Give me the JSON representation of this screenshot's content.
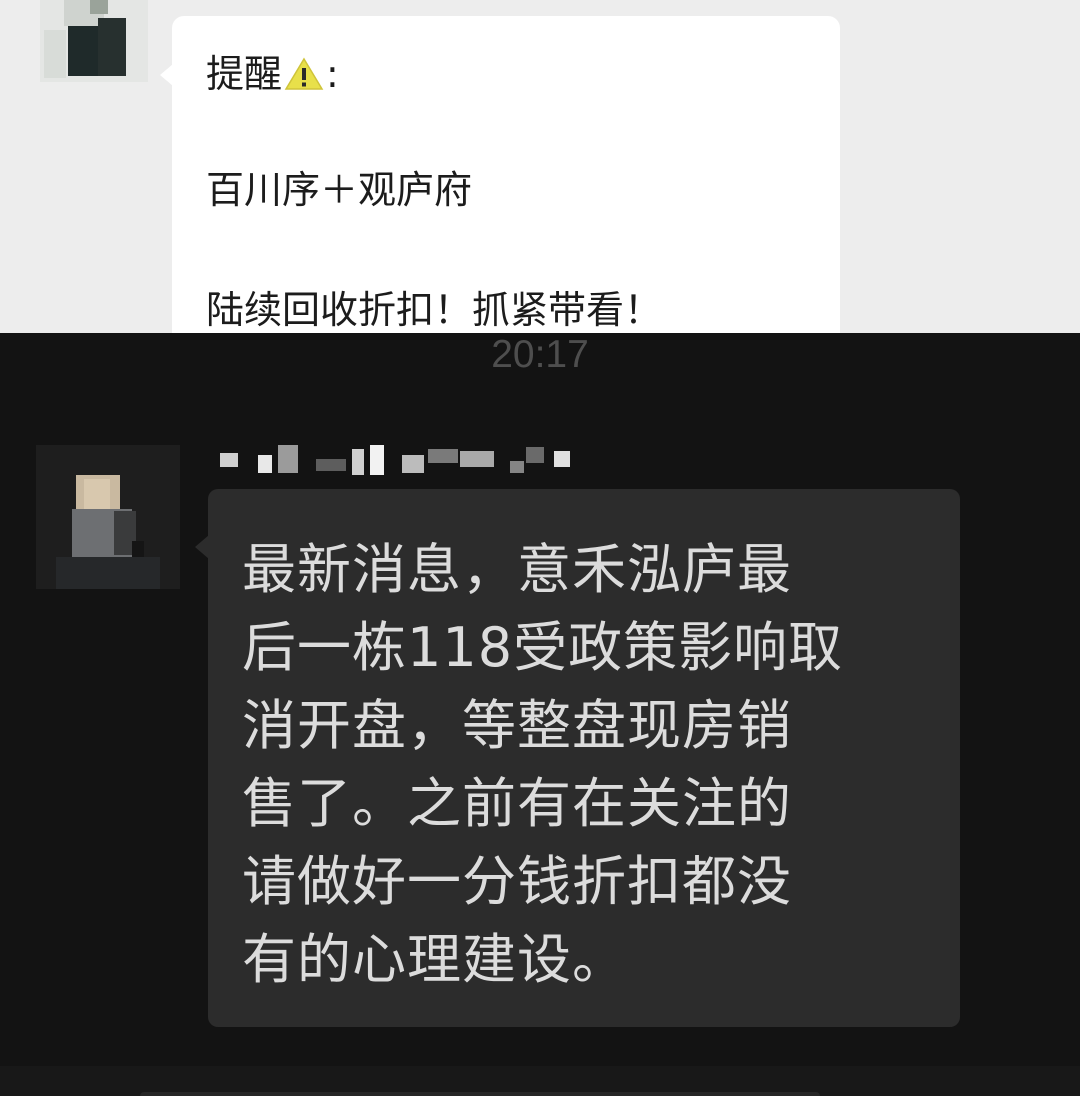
{
  "light_chat": {
    "message": {
      "lines": [
        "提醒",
        "百川序＋观庐府",
        "陆续回收折扣！抓紧带看！"
      ],
      "suffix_colon": ":"
    },
    "icons": {
      "warning": "warning-icon"
    }
  },
  "dark_chat": {
    "timestamp": "20:17",
    "message": {
      "lines": [
        "最新消息，意禾泓庐最",
        "后一栋118受政策影响取",
        "消开盘，等整盘现房销",
        "售了。之前有在关注的",
        "请做好一分钱折扣都没",
        "有的心理建设。"
      ]
    }
  },
  "colors": {
    "light_background": "#ededed",
    "light_bubble": "#ffffff",
    "dark_background": "#131313",
    "dark_bubble": "#2c2c2c",
    "dark_text": "#dcdcdc",
    "warning_yellow": "#e8e04a"
  }
}
